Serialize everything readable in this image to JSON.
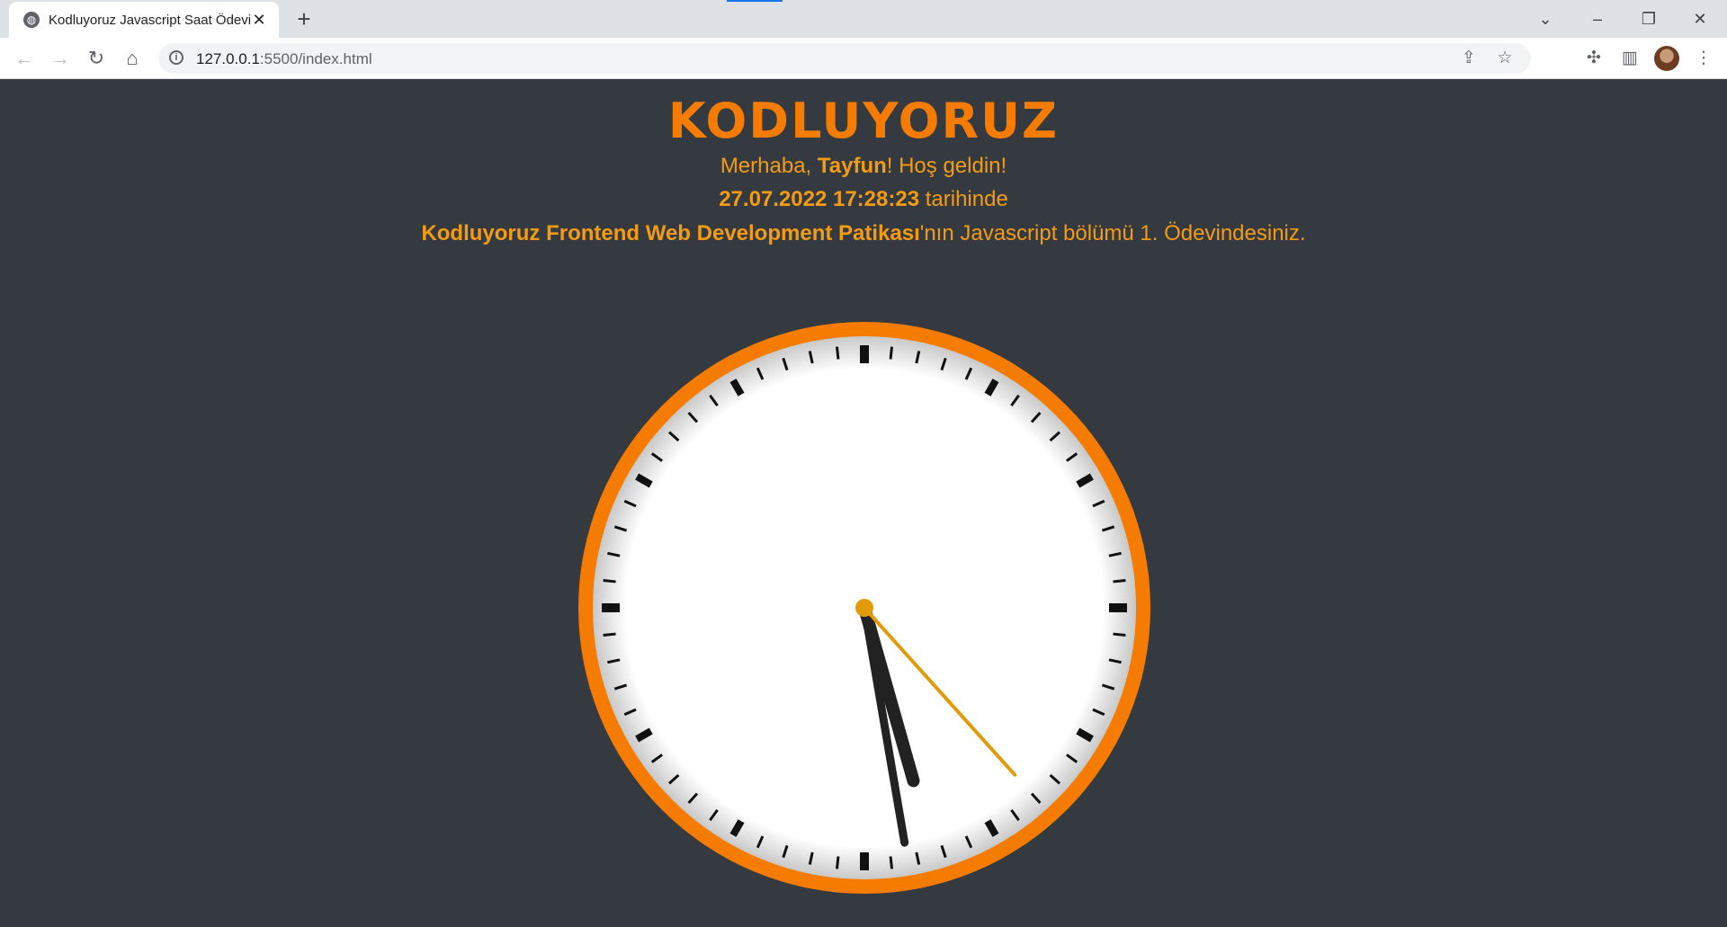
{
  "browser": {
    "tab_title": "Kodluyoruz Javascript Saat Ödevi",
    "url_host": "127.0.0.1",
    "url_rest": ":5500/index.html"
  },
  "page": {
    "logo": "KODLUYORUZ",
    "greeting_prefix": "Merhaba, ",
    "user_name": "Tayfun",
    "greeting_suffix": "! Hoş geldin!",
    "datetime": "27.07.2022 17:28:23",
    "datetime_suffix": " tarihinde",
    "course_name": "Kodluyoruz Frontend Web Development Patikası",
    "course_suffix": "'nın Javascript bölümü 1. Ödevindesiniz."
  },
  "clock": {
    "hours": 17,
    "minutes": 28,
    "seconds": 23,
    "rim_color": "#f57c00",
    "hand_color": "#222222",
    "second_hand_color": "#e09a0a"
  }
}
